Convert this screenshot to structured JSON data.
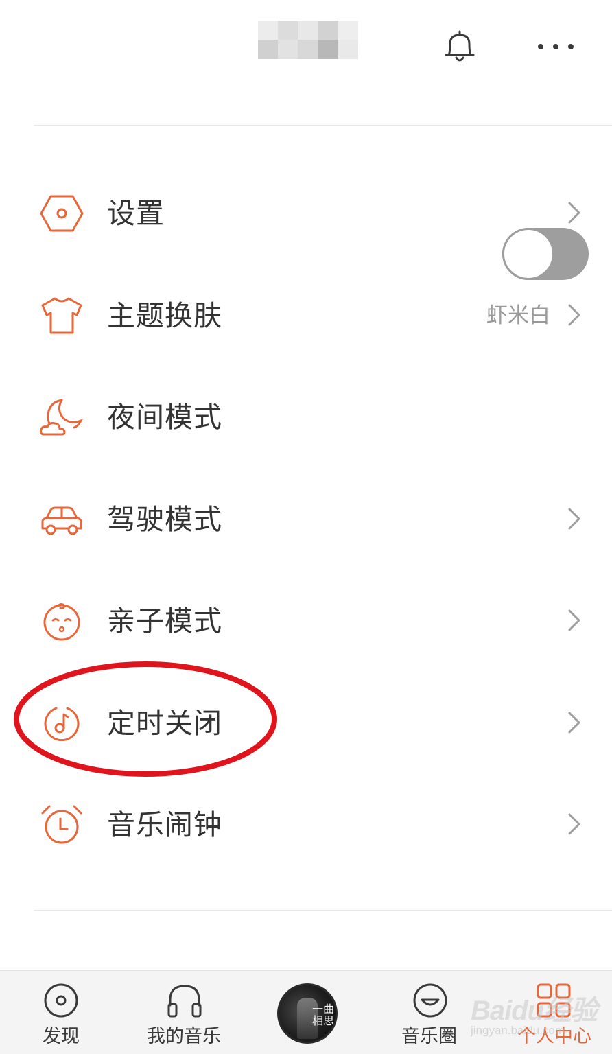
{
  "colors": {
    "accent": "#e8673a",
    "text_primary": "#333333",
    "text_secondary": "#9a9a9a",
    "annotation": "#e0141c",
    "toggle_off": "#9e9e9e"
  },
  "header": {
    "username_blurred": true,
    "bell_icon": "bell-icon",
    "more_icon": "more-icon"
  },
  "menu": {
    "items": [
      {
        "id": "settings",
        "label": "设置",
        "icon": "hexagon-settings-icon",
        "control": "chevron"
      },
      {
        "id": "theme",
        "label": "主题换肤",
        "value": "虾米白",
        "icon": "tshirt-icon",
        "control": "chevron"
      },
      {
        "id": "night",
        "label": "夜间模式",
        "icon": "moon-cloud-icon",
        "control": "toggle",
        "toggle_on": false
      },
      {
        "id": "driving",
        "label": "驾驶模式",
        "icon": "car-icon",
        "control": "chevron"
      },
      {
        "id": "kids",
        "label": "亲子模式",
        "icon": "baby-face-icon",
        "control": "chevron"
      },
      {
        "id": "timer",
        "label": "定时关闭",
        "icon": "timer-note-icon",
        "control": "chevron",
        "highlighted": true
      },
      {
        "id": "alarm",
        "label": "音乐闹钟",
        "icon": "alarm-clock-icon",
        "control": "chevron"
      }
    ]
  },
  "tabbar": {
    "tabs": [
      {
        "id": "discover",
        "label": "发现",
        "icon": "disc-icon"
      },
      {
        "id": "mymusic",
        "label": "我的音乐",
        "icon": "headphones-icon"
      },
      {
        "id": "player",
        "label": "",
        "icon": "now-playing-disc",
        "cover_text": "一曲相思"
      },
      {
        "id": "circle",
        "label": "音乐圈",
        "icon": "smile-bubble-icon"
      },
      {
        "id": "profile",
        "label": "个人中心",
        "icon": "grid-icon",
        "active": true
      }
    ]
  },
  "watermark": {
    "main": "Baidu经验",
    "sub": "jingyan.baidu.com"
  }
}
